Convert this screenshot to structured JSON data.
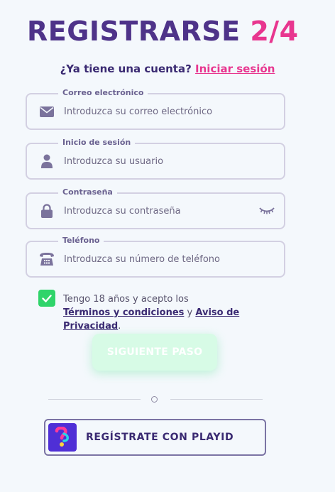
{
  "header": {
    "title": "REGISTRARSE",
    "step": "2/4"
  },
  "login_prompt": {
    "question": "¿Ya tiene una cuenta?",
    "link": "Iniciar sesión"
  },
  "fields": {
    "email": {
      "label": "Correo electrónico",
      "placeholder": "Introduzca su correo electrónico",
      "value": "",
      "icon": "envelope-icon"
    },
    "username": {
      "label": "Inicio de sesión",
      "placeholder": "Introduzca su usuario",
      "value": "",
      "icon": "user-icon"
    },
    "password": {
      "label": "Contraseña",
      "placeholder": "Introduzca su contraseña",
      "value": "",
      "icon": "lock-icon"
    },
    "phone": {
      "label": "Teléfono",
      "placeholder": "Introduzca su número de teléfono",
      "value": "",
      "icon": "telephone-icon"
    }
  },
  "terms": {
    "checked": true,
    "text_before": "Tengo 18 años y acepto los",
    "terms_link": "Términos y condiciones",
    "connector": "y",
    "privacy_link": "Aviso de Privacidad",
    "end": "."
  },
  "buttons": {
    "next_label": "SIGUIENTE PASO",
    "playid_label": "REGÍSTRATE CON PLAYID"
  },
  "colors": {
    "brand_purple": "#4e3389",
    "accent_pink": "#e8368f",
    "check_green": "#2fd46a",
    "next_button_bg": "#d7fbe6",
    "playid_logo_bg": "#4f2fd6"
  }
}
